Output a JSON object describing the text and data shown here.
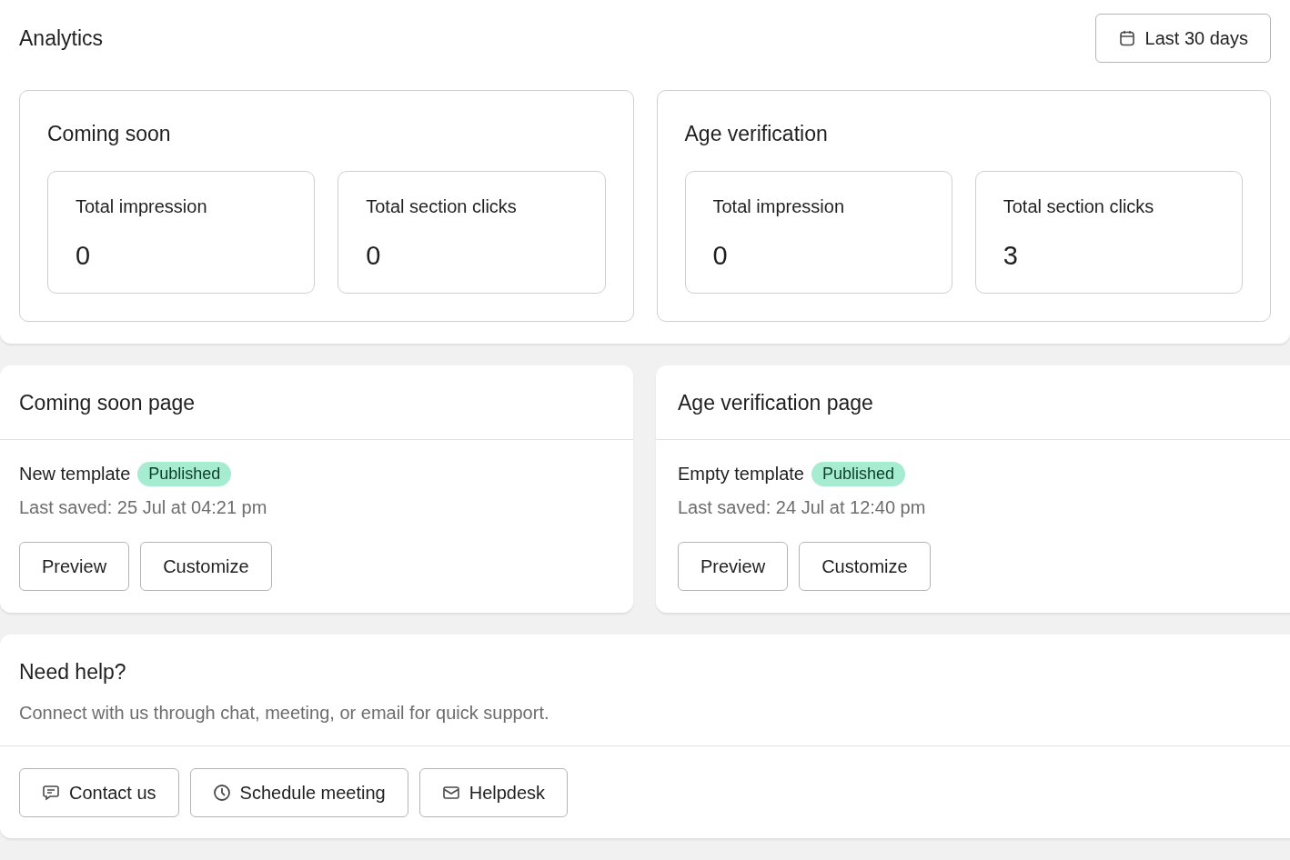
{
  "header": {
    "title": "Analytics",
    "date_range": "Last 30 days"
  },
  "analytics": [
    {
      "title": "Coming soon",
      "stats": [
        {
          "label": "Total impression",
          "value": "0"
        },
        {
          "label": "Total section clicks",
          "value": "0"
        }
      ]
    },
    {
      "title": "Age verification",
      "stats": [
        {
          "label": "Total impression",
          "value": "0"
        },
        {
          "label": "Total section clicks",
          "value": "3"
        }
      ]
    }
  ],
  "pages": [
    {
      "title": "Coming soon page",
      "template": "New template",
      "status": "Published",
      "last_saved": "Last saved: 25 Jul at 04:21 pm",
      "buttons": [
        "Preview",
        "Customize"
      ]
    },
    {
      "title": "Age verification page",
      "template": "Empty template",
      "status": "Published",
      "last_saved": "Last saved: 24 Jul at 12:40 pm",
      "buttons": [
        "Preview",
        "Customize"
      ]
    }
  ],
  "help": {
    "title": "Need help?",
    "text": "Connect with us through chat, meeting, or email for quick support.",
    "buttons": [
      {
        "label": "Contact us",
        "kind": "chat"
      },
      {
        "label": "Schedule meeting",
        "kind": "clock"
      },
      {
        "label": "Helpdesk",
        "kind": "mail"
      }
    ]
  }
}
